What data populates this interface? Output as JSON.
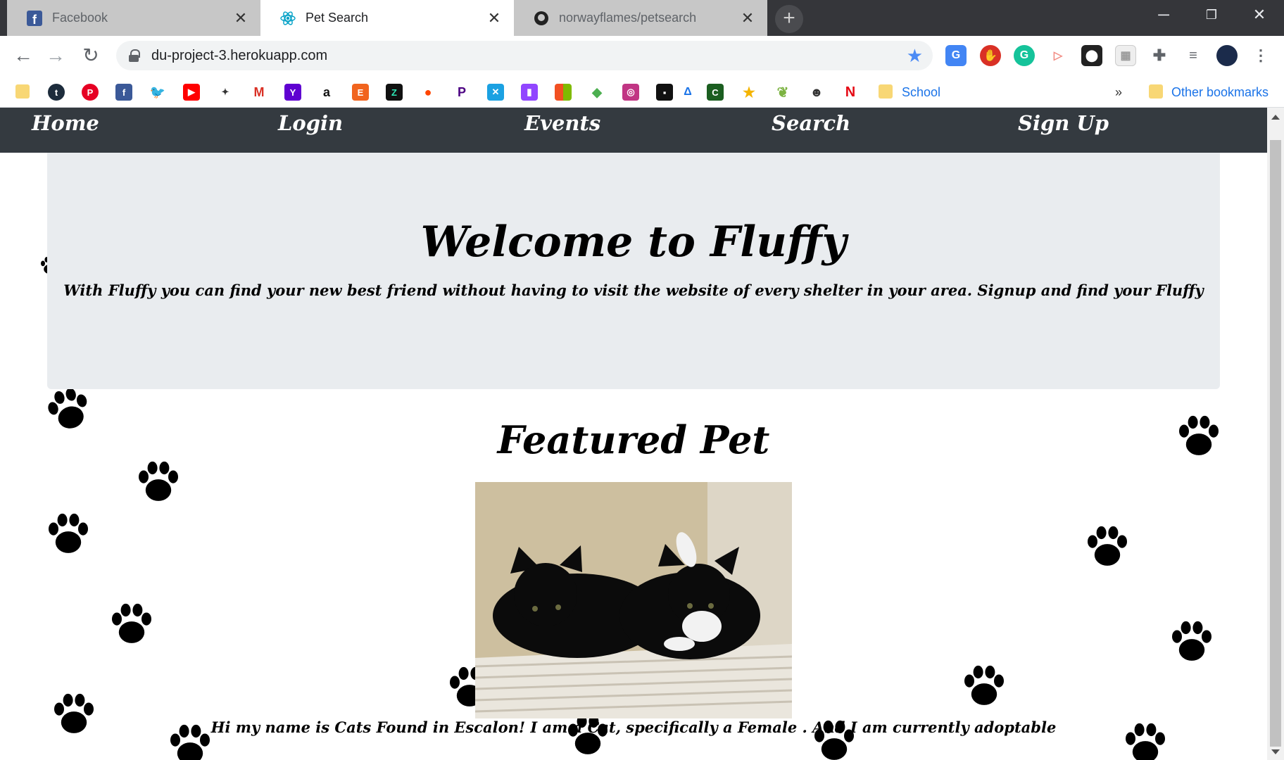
{
  "browser": {
    "tabs": [
      {
        "title": "Facebook",
        "favicon": "facebook-icon"
      },
      {
        "title": "Pet Search",
        "favicon": "react-icon"
      },
      {
        "title": "norwayflames/petsearch",
        "favicon": "github-icon"
      }
    ],
    "url": "du-project-3.herokuapp.com",
    "bookmarks": {
      "school_label": "School",
      "overflow": "»",
      "other_label": "Other bookmarks"
    }
  },
  "nav": {
    "links": [
      "Home",
      "Login",
      "Events",
      "Search",
      "Sign Up"
    ]
  },
  "hero": {
    "title": "Welcome to Fluffy",
    "subtitle": "With Fluffy you can find your new best friend without having to visit the website of every shelter in your area. Signup and find your Fluffy"
  },
  "featured": {
    "heading": "Featured Pet",
    "caption": "Hi my name is Cats Found in Escalon! I am a Cat, specifically a Female . And I am currently adoptable"
  },
  "colors": {
    "navbar": "#343a40",
    "jumbotron": "#e9ecef",
    "link": "#1a73e8"
  }
}
